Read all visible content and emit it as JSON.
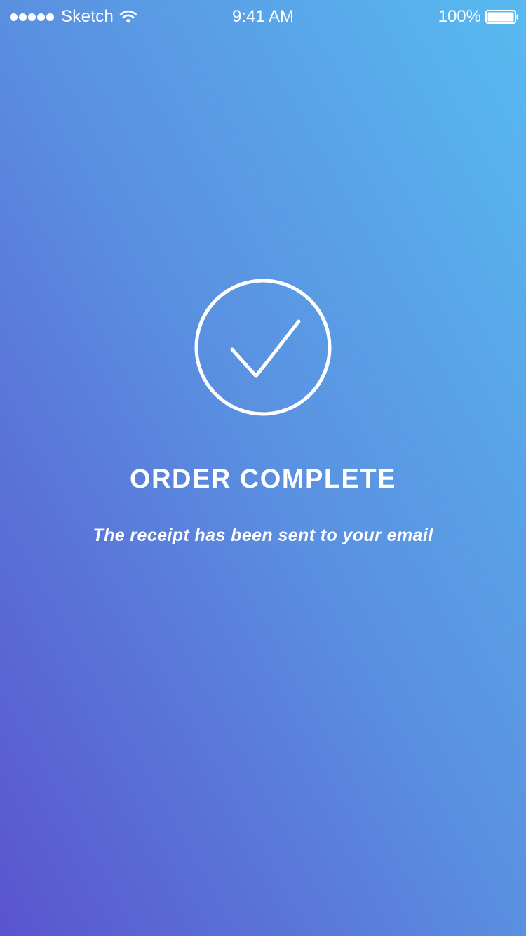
{
  "status_bar": {
    "carrier": "Sketch",
    "time": "9:41 AM",
    "battery_percent": "100%",
    "signal_bars": 5,
    "battery_level": 1.0
  },
  "icons": {
    "signal": "signal-dots-icon",
    "wifi": "wifi-icon",
    "battery": "battery-icon",
    "success": "checkmark-circle-icon"
  },
  "main": {
    "title": "ORDER COMPLETE",
    "subtitle": "The receipt has been sent to your email"
  },
  "colors": {
    "gradient_bottom_left": "#5a54cf",
    "gradient_mid": "#5a8fe0",
    "gradient_top_right": "#58baf0",
    "foreground": "#ffffff"
  }
}
